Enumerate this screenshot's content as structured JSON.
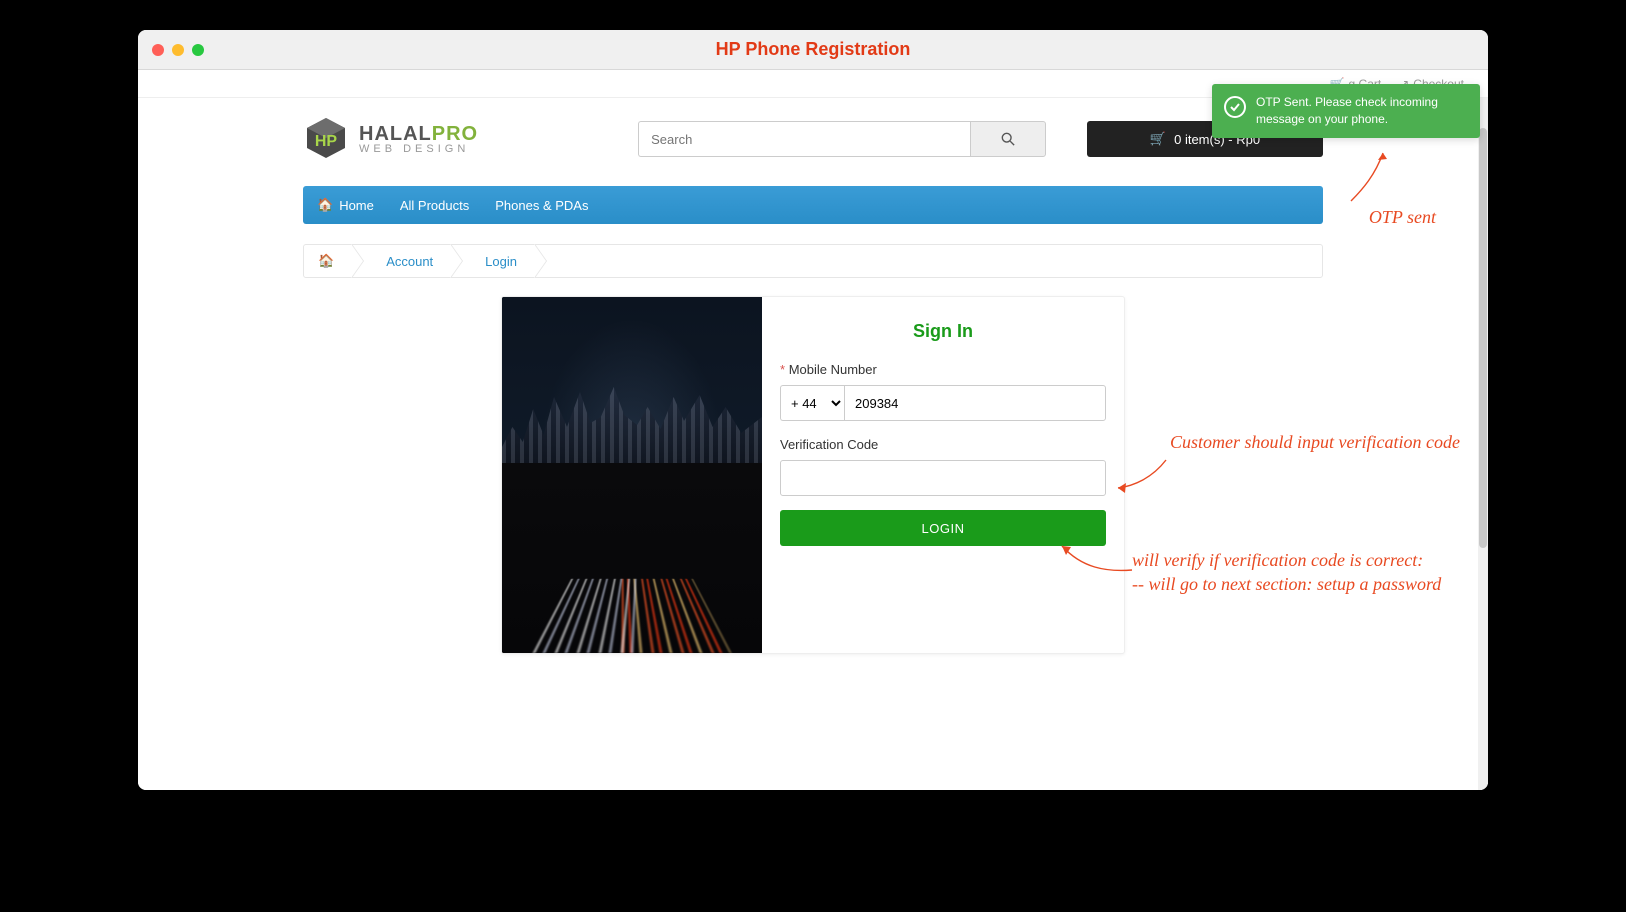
{
  "window": {
    "title": "HP Phone Registration"
  },
  "topbar": {
    "cart_link": "g Cart",
    "checkout_link": "Checkout"
  },
  "logo": {
    "line1_dark": "HALAL",
    "line1_accent": "PRO",
    "line2": "WEB DESIGN"
  },
  "search": {
    "placeholder": "Search"
  },
  "cart": {
    "text": "0 item(s) - Rp0"
  },
  "nav": {
    "home": "Home",
    "all_products": "All Products",
    "phones": "Phones & PDAs"
  },
  "breadcrumb": {
    "account": "Account",
    "login": "Login"
  },
  "sign_in": {
    "heading": "Sign In",
    "mobile_label": "Mobile Number",
    "country_code": "+ 44",
    "phone_value": "209384",
    "verify_label": "Verification Code",
    "login_btn": "LOGIN"
  },
  "toast": {
    "message": "OTP Sent. Please check incoming message on your phone."
  },
  "annotations": {
    "otp_sent": "OTP sent",
    "verify_hint": "Customer should input verification code",
    "login_hint_l1": "will verify if verification code is correct:",
    "login_hint_l2": "-- will go to next section: setup a password"
  }
}
